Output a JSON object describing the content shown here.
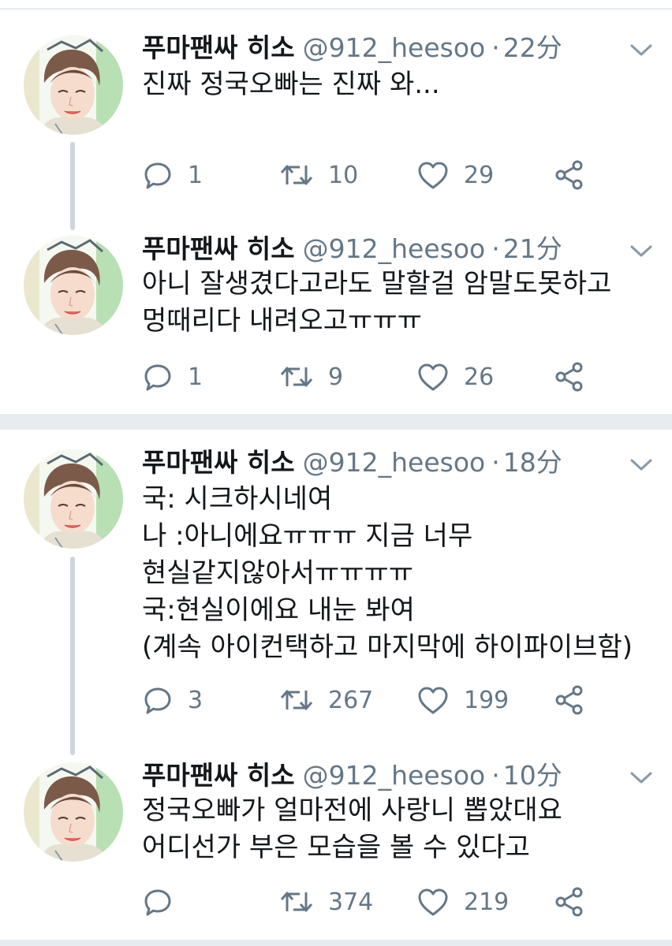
{
  "colors": {
    "text": "#14171a",
    "secondary": "#657786",
    "divider": "#e6ecf0",
    "thread": "#ccd6dd"
  },
  "icons": {
    "reply": "reply-icon",
    "retweet": "retweet-icon",
    "like": "heart-icon",
    "share": "share-icon",
    "caret": "chevron-down-icon"
  },
  "tweets": [
    {
      "name": "푸마팬싸 히소",
      "handle": "@912_heesoo",
      "time": "22分",
      "lines": [
        "진짜 정국오빠는 진짜 와..."
      ],
      "replies": "1",
      "retweets": "10",
      "likes": "29"
    },
    {
      "name": "푸마팬싸 히소",
      "handle": "@912_heesoo",
      "time": "21分",
      "lines": [
        "아니 잘생겼다고라도 말할걸 암말도못하고",
        "멍때리다 내려오고ㅠㅠㅠ"
      ],
      "replies": "1",
      "retweets": "9",
      "likes": "26"
    },
    {
      "name": "푸마팬싸 히소",
      "handle": "@912_heesoo",
      "time": "18分",
      "lines": [
        "국: 시크하시네여",
        "나 :아니에요ㅠㅠㅠ 지금 너무",
        "현실같지않아서ㅠㅠㅠㅠ",
        "국:현실이에요 내눈 봐여",
        "(계속 아이컨택하고 마지막에 하이파이브함)"
      ],
      "replies": "3",
      "retweets": "267",
      "likes": "199"
    },
    {
      "name": "푸마팬싸 히소",
      "handle": "@912_heesoo",
      "time": "10分",
      "lines": [
        "정국오빠가 얼마전에 사랑니 뽑았대요",
        "어디선가 부은 모습을 볼 수 있다고"
      ],
      "replies": "",
      "retweets": "374",
      "likes": "219"
    }
  ]
}
